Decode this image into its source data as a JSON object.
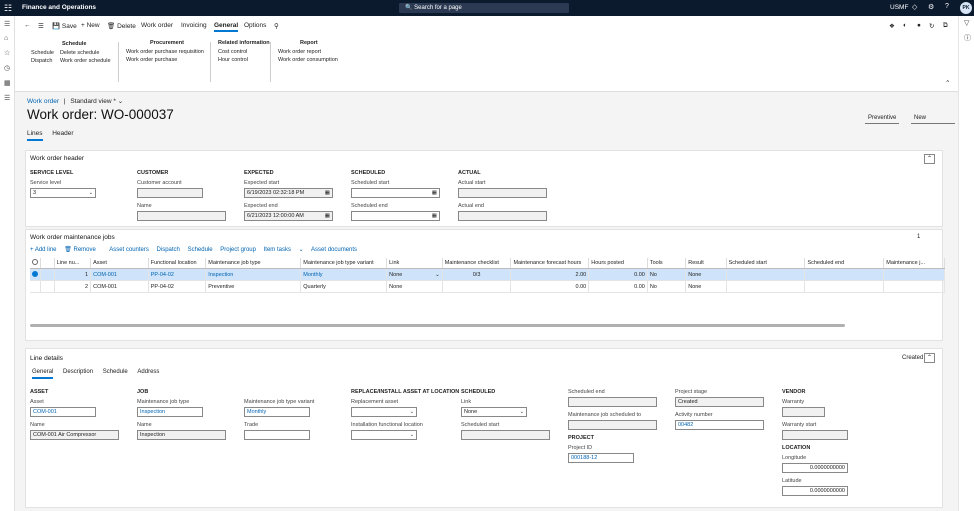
{
  "topbar": {
    "app_name": "Finance and Operations",
    "search_placeholder": "Search for a page",
    "company": "USMF",
    "avatar": "PK"
  },
  "actionbar": {
    "save": "Save",
    "new": "New",
    "delete": "Delete",
    "tabs": [
      "Work order",
      "Invoicing",
      "General",
      "Options"
    ],
    "groups": {
      "schedule": {
        "header": "Schedule",
        "col1": [
          "Schedule",
          "Dispatch"
        ],
        "col2": [
          "Delete schedule",
          "Work order schedule"
        ]
      },
      "procurement": {
        "header": "Procurement",
        "items": [
          "Work order purchase requisition",
          "Work order purchase"
        ]
      },
      "related": {
        "header": "Related information",
        "items": [
          "Cost control",
          "Hour control"
        ]
      },
      "report": {
        "header": "Report",
        "items": [
          "Work order report",
          "Work order consumption"
        ]
      }
    }
  },
  "page": {
    "breadcrumb": "Work order",
    "separator": "|",
    "view": "Standard view *",
    "title": "Work order: WO-000037",
    "right_buttons": [
      "Preventive",
      "New"
    ],
    "tabs": [
      "Lines",
      "Header"
    ]
  },
  "header_panel": {
    "title": "Work order header",
    "service_level": {
      "header": "SERVICE LEVEL",
      "label": "Service level",
      "value": "3"
    },
    "customer": {
      "header": "CUSTOMER",
      "account_label": "Customer account",
      "account": "",
      "name_label": "Name",
      "name": ""
    },
    "expected": {
      "header": "EXPECTED",
      "start_label": "Expected start",
      "start": "6/19/2023 02:32:18 PM",
      "end_label": "Expected end",
      "end": "6/21/2023 12:00:00 AM"
    },
    "scheduled": {
      "header": "SCHEDULED",
      "start_label": "Scheduled start",
      "start": "",
      "end_label": "Scheduled end",
      "end": ""
    },
    "actual": {
      "header": "ACTUAL",
      "start_label": "Actual start",
      "start": "",
      "end_label": "Actual end",
      "end": ""
    }
  },
  "jobs_panel": {
    "title": "Work order maintenance jobs",
    "page_num": "1",
    "toolbar": [
      "+ Add line",
      "Remove",
      "Asset counters",
      "Dispatch",
      "Schedule",
      "Project group",
      "Item tasks",
      "Asset documents"
    ],
    "columns": [
      "Line nu...",
      "Asset",
      "Functional location",
      "Maintenance job type",
      "Maintenance job type variant",
      "Link",
      "Maintenance checklist",
      "Maintenance forecast hours",
      "Hours posted",
      "Tools",
      "Result",
      "Scheduled start",
      "Scheduled end",
      "Maintenance j..."
    ],
    "rows": [
      {
        "line": "1",
        "asset": "COM-001",
        "floc": "PP-04-02",
        "jobtype": "Inspection",
        "variant": "Monthly",
        "link": "None",
        "checklist": "0/3",
        "forecast": "2.00",
        "posted": "0.00",
        "tools": "No",
        "result": "None"
      },
      {
        "line": "2",
        "asset": "COM-001",
        "floc": "PP-04-02",
        "jobtype": "Preventive",
        "variant": "Quarterly",
        "link": "None",
        "checklist": "",
        "forecast": "0.00",
        "posted": "0.00",
        "tools": "No",
        "result": "None"
      }
    ]
  },
  "line_details": {
    "title": "Line details",
    "status": "Created",
    "tabs": [
      "General",
      "Description",
      "Schedule",
      "Address"
    ],
    "asset": {
      "header": "ASSET",
      "asset_label": "Asset",
      "asset": "COM-001",
      "name_label": "Name",
      "name": "COM-001 Air Compressor"
    },
    "job": {
      "header": "JOB",
      "type_label": "Maintenance job type",
      "type": "Inspection",
      "name_label": "Name",
      "name": "Inspection"
    },
    "variant": {
      "label": "Maintenance job type variant",
      "value": "Monthly",
      "trade_label": "Trade",
      "trade": ""
    },
    "replace": {
      "header": "REPLACE/INSTALL ASSET AT LOCATION",
      "asset_label": "Replacement asset",
      "asset": "",
      "floc_label": "Installation functional location",
      "floc": ""
    },
    "scheduled": {
      "header": "SCHEDULED",
      "link_label": "Link",
      "link": "None",
      "start_label": "Scheduled start",
      "start": ""
    },
    "sched2": {
      "end_label": "Scheduled end",
      "end": "",
      "to_label": "Maintenance job scheduled to",
      "to": ""
    },
    "project": {
      "header": "PROJECT",
      "id_label": "Project ID",
      "id": "000188-12"
    },
    "stage": {
      "label": "Project stage",
      "value": "Created",
      "activity_label": "Activity number",
      "activity": "00482"
    },
    "vendor": {
      "header": "VENDOR",
      "warranty_label": "Warranty",
      "warranty": "",
      "wstart_label": "Warranty start",
      "wstart": ""
    },
    "location": {
      "header": "LOCATION",
      "lon_label": "Longitude",
      "lon": "0.0000000000",
      "lat_label": "Latitude",
      "lat": "0.0000000000"
    }
  },
  "colors": {
    "topbar": "#0c1a2e",
    "accent": "#0078d4",
    "link": "#0063b1",
    "selected_row": "#cfe4fa"
  }
}
